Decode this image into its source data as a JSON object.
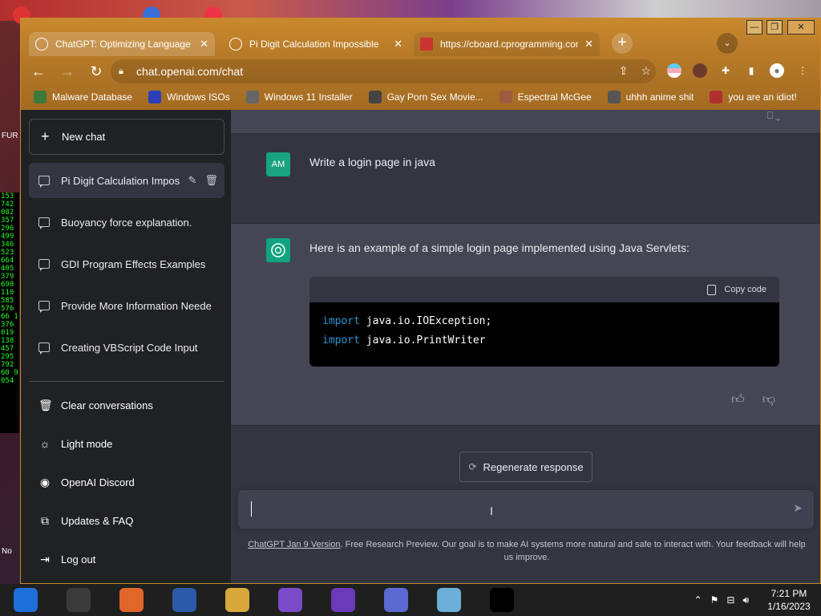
{
  "desktop": {
    "left_labels": [
      "FUR",
      "No"
    ],
    "number_strip": [
      "153",
      "742",
      "082",
      "357",
      "296",
      "499",
      "346",
      "523",
      "664",
      "405",
      "379",
      "698",
      "110",
      "585",
      "576",
      "66 1",
      "376",
      "019",
      "138",
      "457",
      "295",
      "792",
      "60 9",
      "054"
    ]
  },
  "window_controls": {
    "minimize": "—",
    "maximize": "❐",
    "close": "✕"
  },
  "tabs": [
    {
      "title": "ChatGPT: Optimizing Language M",
      "icon": "chatgpt-icon"
    },
    {
      "title": "Pi Digit Calculation Impossible",
      "icon": "chatgpt-icon"
    },
    {
      "title": "https://cboard.cprogramming.com",
      "icon": "cboard-icon"
    }
  ],
  "new_tab_label": "+",
  "tab_menu_label": "⌄",
  "address_bar": {
    "url": "chat.openai.com/chat"
  },
  "bookmarks": [
    {
      "label": "Malware Database",
      "icon": "malware-db-icon",
      "color": "#3a7a3a"
    },
    {
      "label": "Windows ISOs",
      "icon": "x-icon",
      "color": "#2b3fb8"
    },
    {
      "label": "Windows 11 Installer",
      "icon": "image-icon",
      "color": "#666666"
    },
    {
      "label": "Gay Porn Sex Movie...",
      "icon": "bookmark-icon",
      "color": "#444444"
    },
    {
      "label": "Espectral McGee",
      "icon": "avatar-icon",
      "color": "#a05a40"
    },
    {
      "label": "uhhh anime shit",
      "icon": "anime-icon",
      "color": "#555555"
    },
    {
      "label": "you are an idiot!",
      "icon": "flag-icon",
      "color": "#b03030"
    }
  ],
  "sidebar": {
    "new_chat": "New chat",
    "conversations": [
      {
        "title": "Pi Digit Calculation Impos",
        "selected": true
      },
      {
        "title": "Buoyancy force explanation.",
        "selected": false
      },
      {
        "title": "GDI Program Effects Examples",
        "selected": false
      },
      {
        "title": "Provide More Information Neede",
        "selected": false
      },
      {
        "title": "Creating VBScript Code Input",
        "selected": false
      }
    ],
    "links": [
      {
        "label": "Clear conversations",
        "icon": "trash-icon"
      },
      {
        "label": "Light mode",
        "icon": "sun-icon"
      },
      {
        "label": "OpenAI Discord",
        "icon": "discord-icon"
      },
      {
        "label": "Updates & FAQ",
        "icon": "external-link-icon"
      },
      {
        "label": "Log out",
        "icon": "logout-icon"
      }
    ]
  },
  "chat": {
    "user_avatar": "AM",
    "user_message": "Write a login page in java",
    "bot_message": "Here is an example of a simple login page implemented using Java Servlets:",
    "code": {
      "copy_label": "Copy code",
      "lines": [
        {
          "kw": "import",
          "rest": " java.io.IOException;"
        },
        {
          "kw": "import",
          "rest": " java.io.PrintWriter"
        }
      ]
    },
    "regenerate": "Regenerate response",
    "footer_version": "ChatGPT Jan 9 Version",
    "footer_text": ". Free Research Preview. Our goal is to make AI systems more natural and safe to interact with. Your feedback will help us improve."
  },
  "taskbar": {
    "apps": [
      {
        "name": "chrome-canary",
        "color": "#1e6fd9"
      },
      {
        "name": "chrome",
        "color": "#3a3a3a"
      },
      {
        "name": "firefox",
        "color": "#e0662a"
      },
      {
        "name": "obama",
        "color": "#2b5aa8"
      },
      {
        "name": "file-explorer",
        "color": "#d9a83a"
      },
      {
        "name": "visual-studio-installer",
        "color": "#7a4ac8"
      },
      {
        "name": "visual-studio",
        "color": "#6a3ab8"
      },
      {
        "name": "people",
        "color": "#5a6ad0"
      },
      {
        "name": "notepad",
        "color": "#6ab0d8"
      },
      {
        "name": "command-prompt",
        "color": "#000000"
      }
    ],
    "time": "7:21 PM",
    "date": "1/16/2023"
  }
}
